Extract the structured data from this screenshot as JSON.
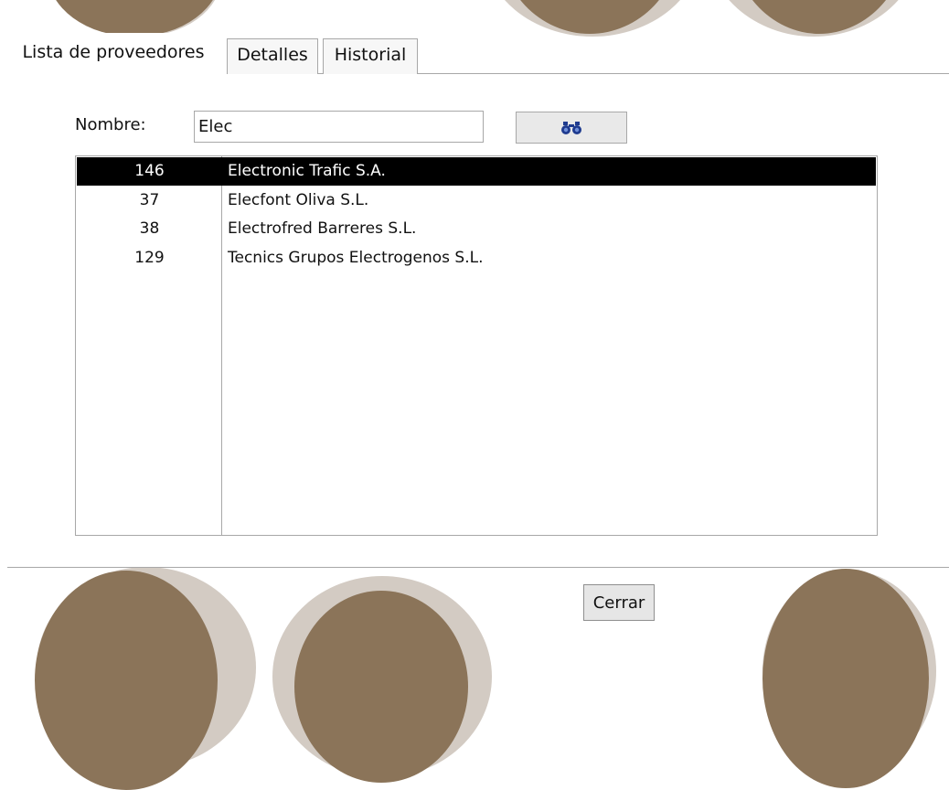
{
  "tabs": [
    {
      "label": "Lista de proveedores",
      "active": true
    },
    {
      "label": "Detalles",
      "active": false
    },
    {
      "label": "Historial",
      "active": false
    }
  ],
  "search": {
    "label": "Nombre:",
    "value": "Elec",
    "button_icon": "binoculars-icon"
  },
  "suppliers": {
    "rows": [
      {
        "id": "146",
        "name": "Electronic Trafic S.A.",
        "selected": true
      },
      {
        "id": "37",
        "name": "Elecfont Oliva S.L.",
        "selected": false
      },
      {
        "id": "38",
        "name": "Electrofred Barreres S.L.",
        "selected": false
      },
      {
        "id": "129",
        "name": "Tecnics Grupos Electrogenos S.L.",
        "selected": false
      }
    ]
  },
  "footer": {
    "close_label": "Cerrar"
  },
  "colors": {
    "decor_dark": "#8b7459",
    "decor_light": "#d3cbc3",
    "selection": "#000000"
  }
}
